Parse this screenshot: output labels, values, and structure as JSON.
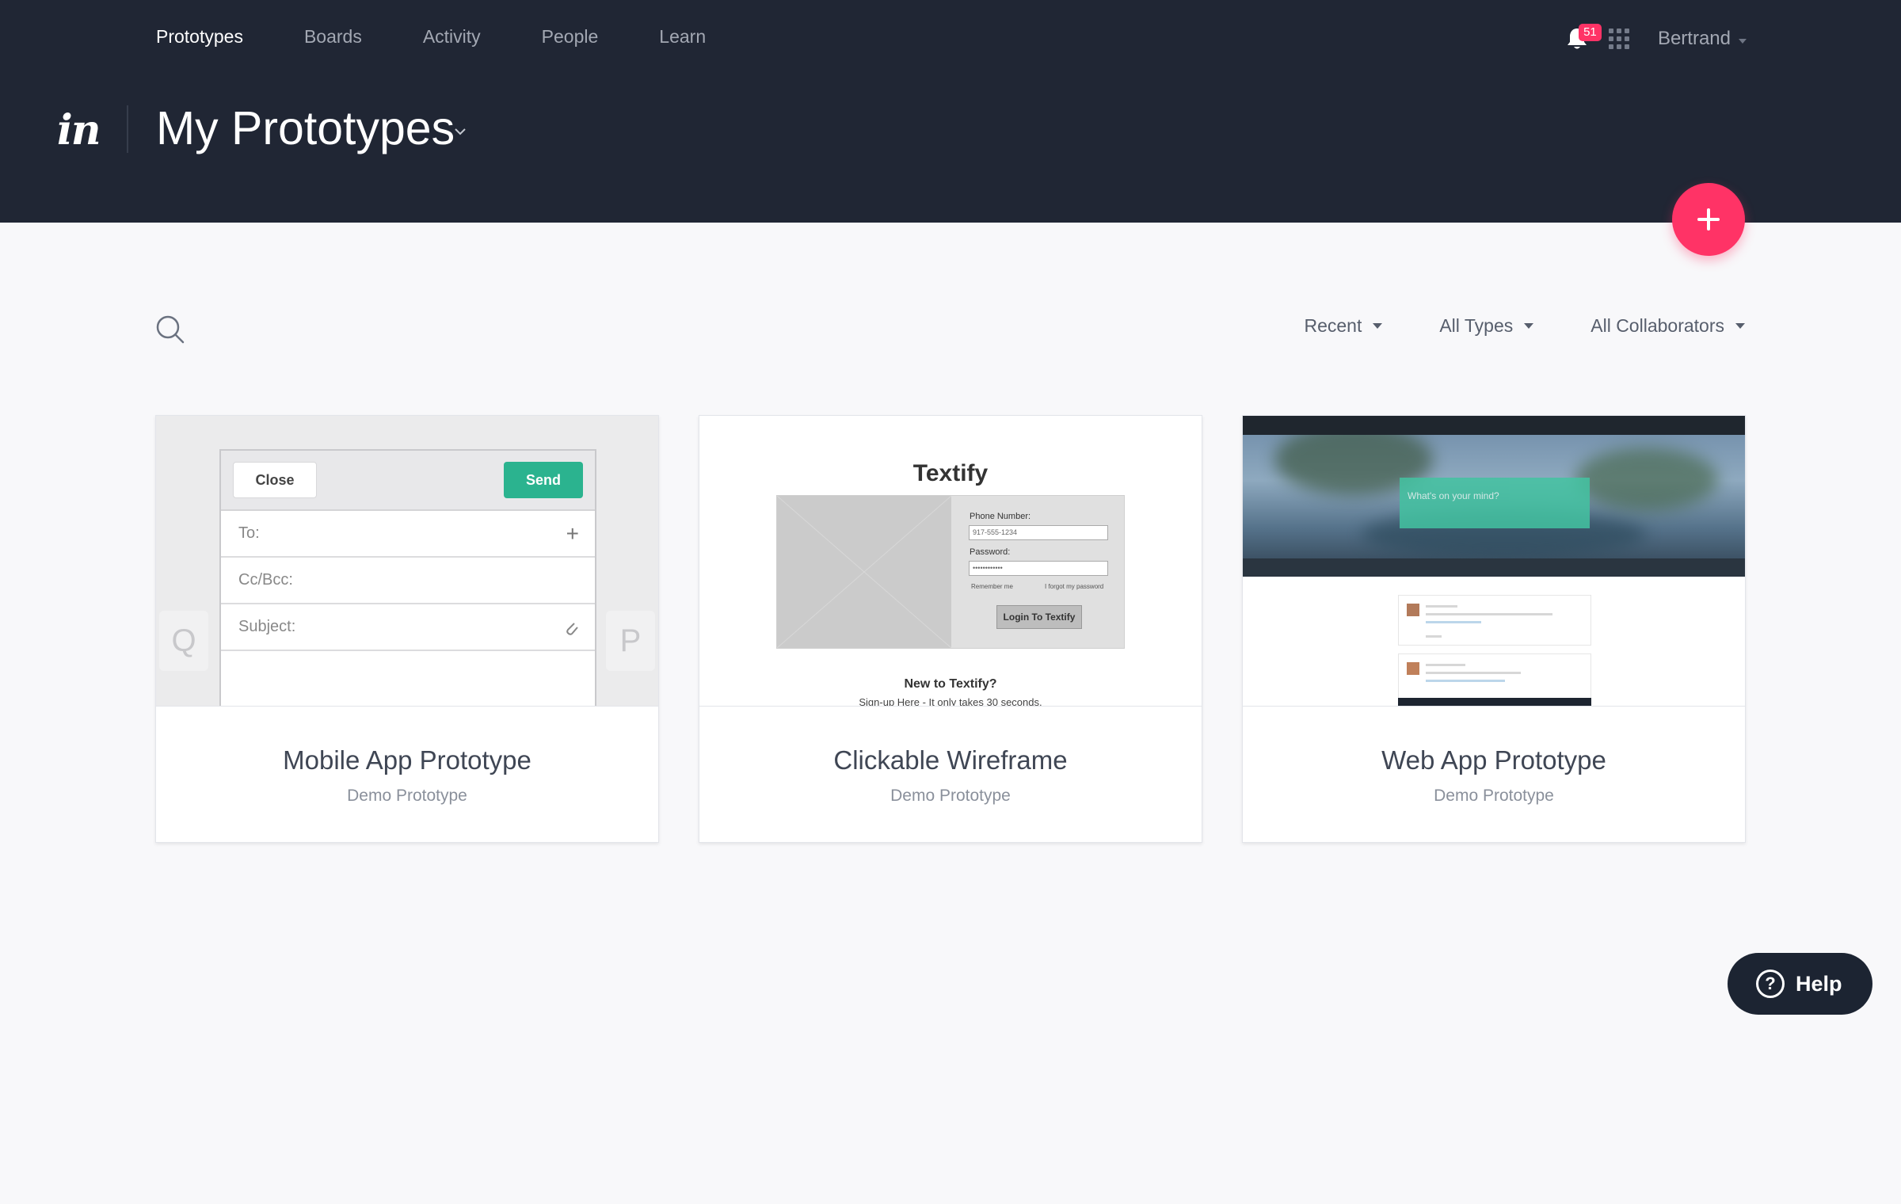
{
  "nav": {
    "items": [
      {
        "label": "Prototypes",
        "active": true
      },
      {
        "label": "Boards",
        "active": false
      },
      {
        "label": "Activity",
        "active": false
      },
      {
        "label": "People",
        "active": false
      },
      {
        "label": "Learn",
        "active": false
      }
    ]
  },
  "user": {
    "notifications": "51",
    "name": "Bertrand",
    "notification_icon": "bell-icon",
    "apps_icon": "grid-icon"
  },
  "brand": {
    "logo": "in"
  },
  "page": {
    "title": "My Prototypes"
  },
  "toolbar": {
    "search_icon": "search-icon",
    "filters": [
      {
        "label": "Recent"
      },
      {
        "label": "All Types"
      },
      {
        "label": "All Collaborators"
      }
    ]
  },
  "cards": [
    {
      "title": "Mobile App Prototype",
      "subtitle": "Demo Prototype",
      "preview": {
        "close": "Close",
        "send": "Send",
        "to": "To:",
        "cc": "Cc/Bcc:",
        "subject": "Subject:",
        "key_left": "Q",
        "key_right": "P"
      }
    },
    {
      "title": "Clickable Wireframe",
      "subtitle": "Demo Prototype",
      "preview": {
        "heading": "Textify",
        "phone_label": "Phone Number:",
        "phone_value": "917-555-1234",
        "password_label": "Password:",
        "password_value": "••••••••••••",
        "remember": "Remember me",
        "forgot": "I forgot my password",
        "login": "Login To Textify",
        "new_heading": "New to Textify?",
        "signup": "Sign-up Here - It only takes 30 seconds."
      }
    },
    {
      "title": "Web App Prototype",
      "subtitle": "Demo Prototype",
      "preview": {
        "post_prompt": "What's on your mind?"
      }
    }
  ],
  "help": {
    "label": "Help"
  },
  "colors": {
    "header_bg": "#202634",
    "accent": "#ff3366",
    "send_green": "#2bb38f"
  }
}
